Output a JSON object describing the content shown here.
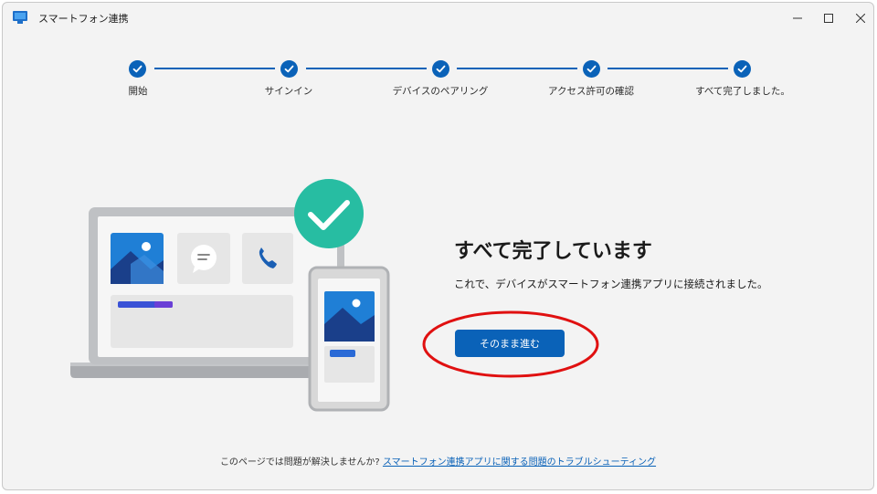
{
  "window": {
    "title": "スマートフォン連携",
    "app_icon": "phone-link-icon",
    "controls": [
      "minimize-icon",
      "maximize-icon",
      "close-icon"
    ]
  },
  "stepper": {
    "steps": [
      {
        "label": "開始",
        "status": "complete"
      },
      {
        "label": "サインイン",
        "status": "complete"
      },
      {
        "label": "デバイスのペアリング",
        "status": "complete"
      },
      {
        "label": "アクセス許可の確認",
        "status": "complete"
      },
      {
        "label": "すべて完了しました。",
        "status": "complete"
      }
    ],
    "accent_color": "#0a62b8"
  },
  "main": {
    "heading": "すべて完了しています",
    "description": "これで、デバイスがスマートフォン連携アプリに接続されました。",
    "continue_button": "そのまま進む"
  },
  "footer": {
    "text": "このページでは問題が解決しませんか?",
    "link": "スマートフォン連携アプリに関する問題のトラブルシューティング"
  },
  "colors": {
    "accent": "#0a62b8",
    "success": "#2bc4a9",
    "annotation": "#e01010"
  }
}
